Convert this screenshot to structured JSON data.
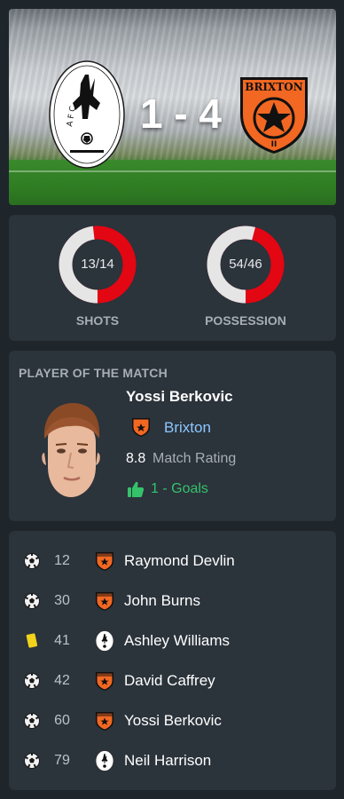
{
  "match": {
    "home_badge": "home-club-crest",
    "home_badge_text": "A F C",
    "away_badge": "brixton-crest",
    "away_badge_text": "BRIXTON",
    "score": "1 - 4"
  },
  "stats": [
    {
      "value": "13/14",
      "label": "SHOTS",
      "home_share": 0.48,
      "colors": {
        "home": "#e5e5e5",
        "away": "#e30613"
      }
    },
    {
      "value": "54/46",
      "label": "POSSESSION",
      "home_share": 0.54,
      "colors": {
        "home": "#e5e5e5",
        "away": "#e30613"
      }
    }
  ],
  "potm": {
    "title": "PLAYER OF THE MATCH",
    "name": "Yossi Berkovic",
    "club": "Brixton",
    "rating": "8.8",
    "rating_label": "Match Rating",
    "highlight": "1 - Goals",
    "highlight_icon": "thumbs-up-icon"
  },
  "events": [
    {
      "type": "goal",
      "icon": "football-icon",
      "minute": "12",
      "team": "away",
      "player": "Raymond Devlin"
    },
    {
      "type": "goal",
      "icon": "football-icon",
      "minute": "30",
      "team": "away",
      "player": "John Burns"
    },
    {
      "type": "yellow-card",
      "icon": "yellow-card-icon",
      "minute": "41",
      "team": "home",
      "player": "Ashley Williams"
    },
    {
      "type": "goal",
      "icon": "football-icon",
      "minute": "42",
      "team": "away",
      "player": "David Caffrey"
    },
    {
      "type": "goal",
      "icon": "football-icon",
      "minute": "60",
      "team": "away",
      "player": "Yossi Berkovic"
    },
    {
      "type": "goal",
      "icon": "football-icon",
      "minute": "79",
      "team": "home",
      "player": "Neil Harrison"
    }
  ],
  "colors": {
    "accent_red": "#e30613",
    "club_orange": "#f26722",
    "positive_green": "#35c26b",
    "link_blue": "#8cc7ff",
    "card_yellow": "#f2d21b"
  }
}
